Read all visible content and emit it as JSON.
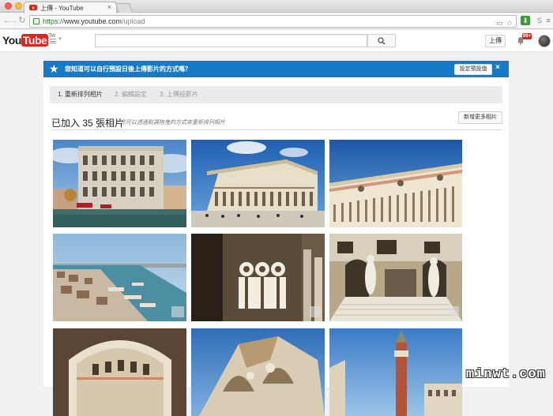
{
  "browser": {
    "tab_title": "上傳 - YouTube",
    "tab_close": "×",
    "url_scheme": "https://",
    "url_host": "www.youtube.com",
    "url_path": "/upload",
    "back_icon": "←",
    "forward_icon": "→",
    "reload_icon": "↻"
  },
  "youtube": {
    "logo_you": "You",
    "logo_tube": "Tube",
    "logo_region": "TW",
    "search_icon": "⚲",
    "upload_label": "上傳",
    "notification_count": "99+"
  },
  "banner": {
    "star": "★",
    "message": "您知道可以自行預設日後上傳影片的方式嗎？",
    "settings_button": "設定預設值",
    "close": "×"
  },
  "steps": [
    {
      "label": "1. 重新排列相片"
    },
    {
      "label": "2. 編輯設定"
    },
    {
      "label": "3. 上傳投影片"
    }
  ],
  "upload": {
    "added_title": "已加入 35 張相片",
    "hint": "您可以透過點選拖曳的方式來重新排列相片",
    "add_more_button": "新增更多相片"
  },
  "photos": [
    {
      "subject": "palazzo-facade"
    },
    {
      "subject": "doges-palace-sky"
    },
    {
      "subject": "doges-palace-arcade"
    },
    {
      "subject": "grand-canal-waterfront"
    },
    {
      "subject": "gothic-loggia-interior"
    },
    {
      "subject": "giants-staircase"
    },
    {
      "subject": "courtyard-arch"
    },
    {
      "subject": "basilica-detail"
    },
    {
      "subject": "campanile-piazza"
    }
  ],
  "watermark": "minwt.com"
}
